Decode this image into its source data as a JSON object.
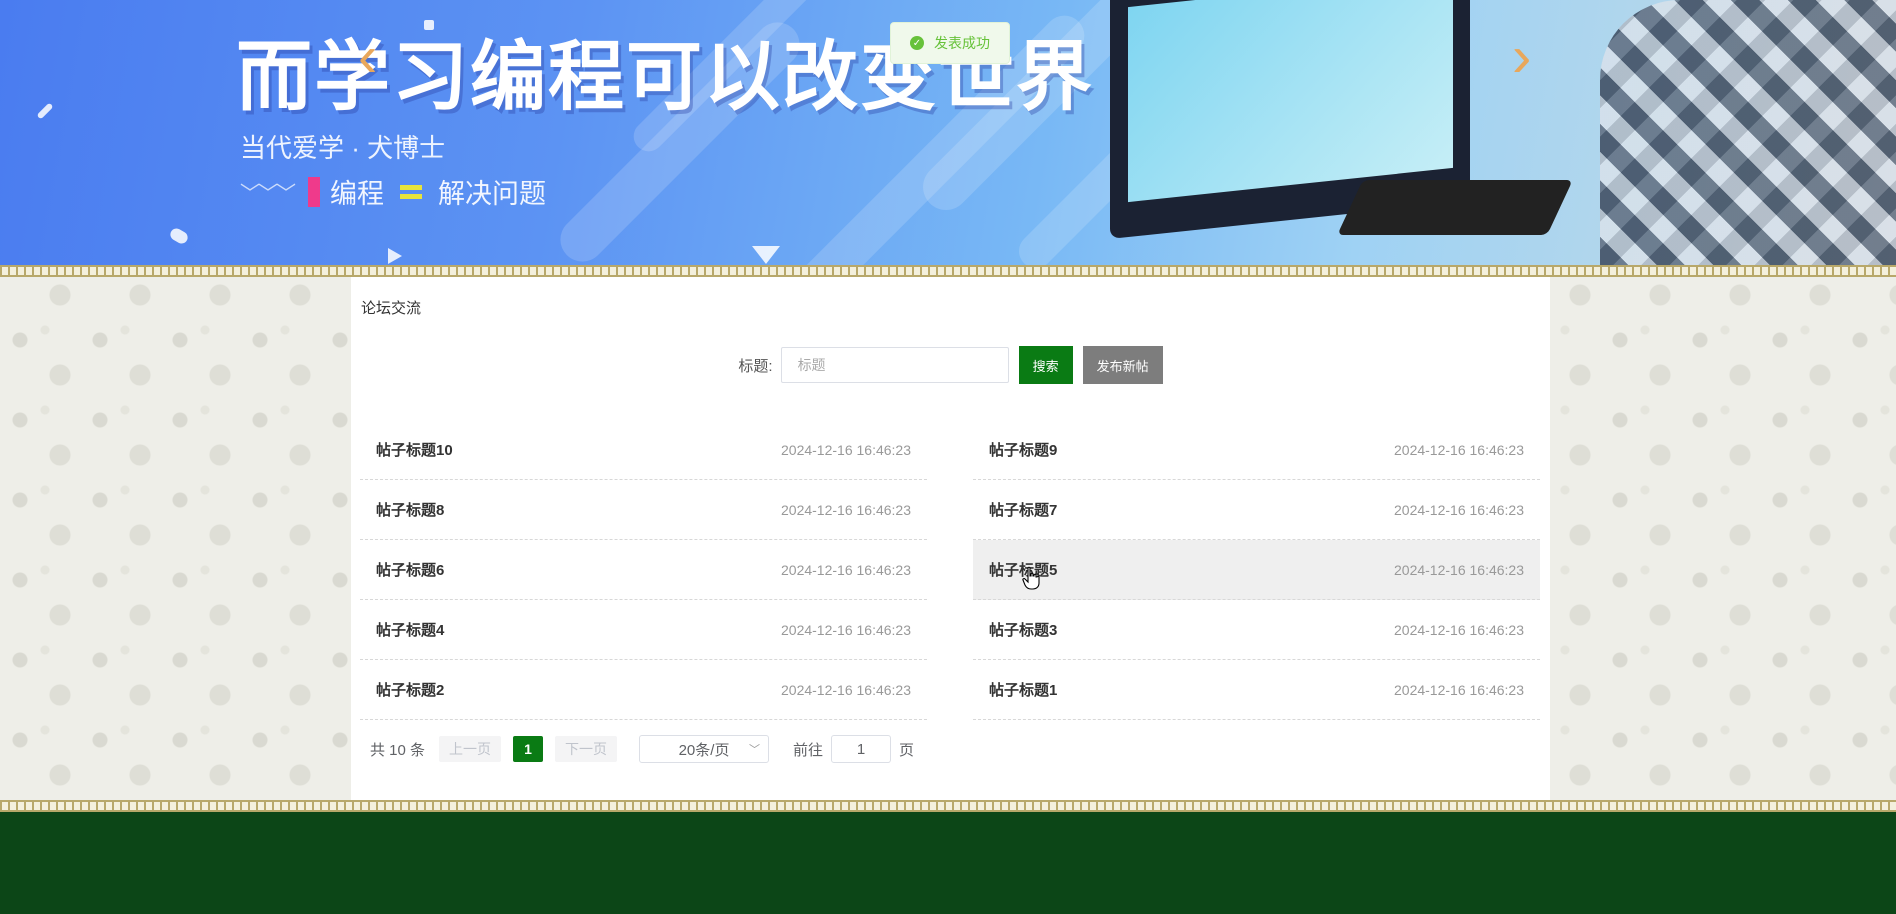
{
  "banner": {
    "headline": "而学习编程可以改变世界",
    "subline": "当代爱学 · 犬博士",
    "slogan_left": "编程",
    "slogan_right": "解决问题",
    "prev_arrow": "‹",
    "next_arrow": "›"
  },
  "toast": {
    "message": "发表成功"
  },
  "forum": {
    "section_title": "论坛交流",
    "search_label": "标题:",
    "search_placeholder": "标题",
    "search_button": "搜索",
    "publish_button": "发布新帖",
    "posts_left": [
      {
        "title": "帖子标题10",
        "time": "2024-12-16 16:46:23"
      },
      {
        "title": "帖子标题8",
        "time": "2024-12-16 16:46:23"
      },
      {
        "title": "帖子标题6",
        "time": "2024-12-16 16:46:23"
      },
      {
        "title": "帖子标题4",
        "time": "2024-12-16 16:46:23"
      },
      {
        "title": "帖子标题2",
        "time": "2024-12-16 16:46:23"
      }
    ],
    "posts_right": [
      {
        "title": "帖子标题9",
        "time": "2024-12-16 16:46:23"
      },
      {
        "title": "帖子标题7",
        "time": "2024-12-16 16:46:23"
      },
      {
        "title": "帖子标题5",
        "time": "2024-12-16 16:46:23"
      },
      {
        "title": "帖子标题3",
        "time": "2024-12-16 16:46:23"
      },
      {
        "title": "帖子标题1",
        "time": "2024-12-16 16:46:23"
      }
    ]
  },
  "pagination": {
    "total": "共 10 条",
    "prev": "上一页",
    "current": "1",
    "next": "下一页",
    "page_size": "20条/页",
    "goto_label": "前往",
    "goto_value": "1",
    "unit": "页"
  },
  "colors": {
    "accent": "#0a7b14",
    "footer": "#0c4617",
    "publish": "#7d7d7d",
    "success": "#67c23a"
  }
}
